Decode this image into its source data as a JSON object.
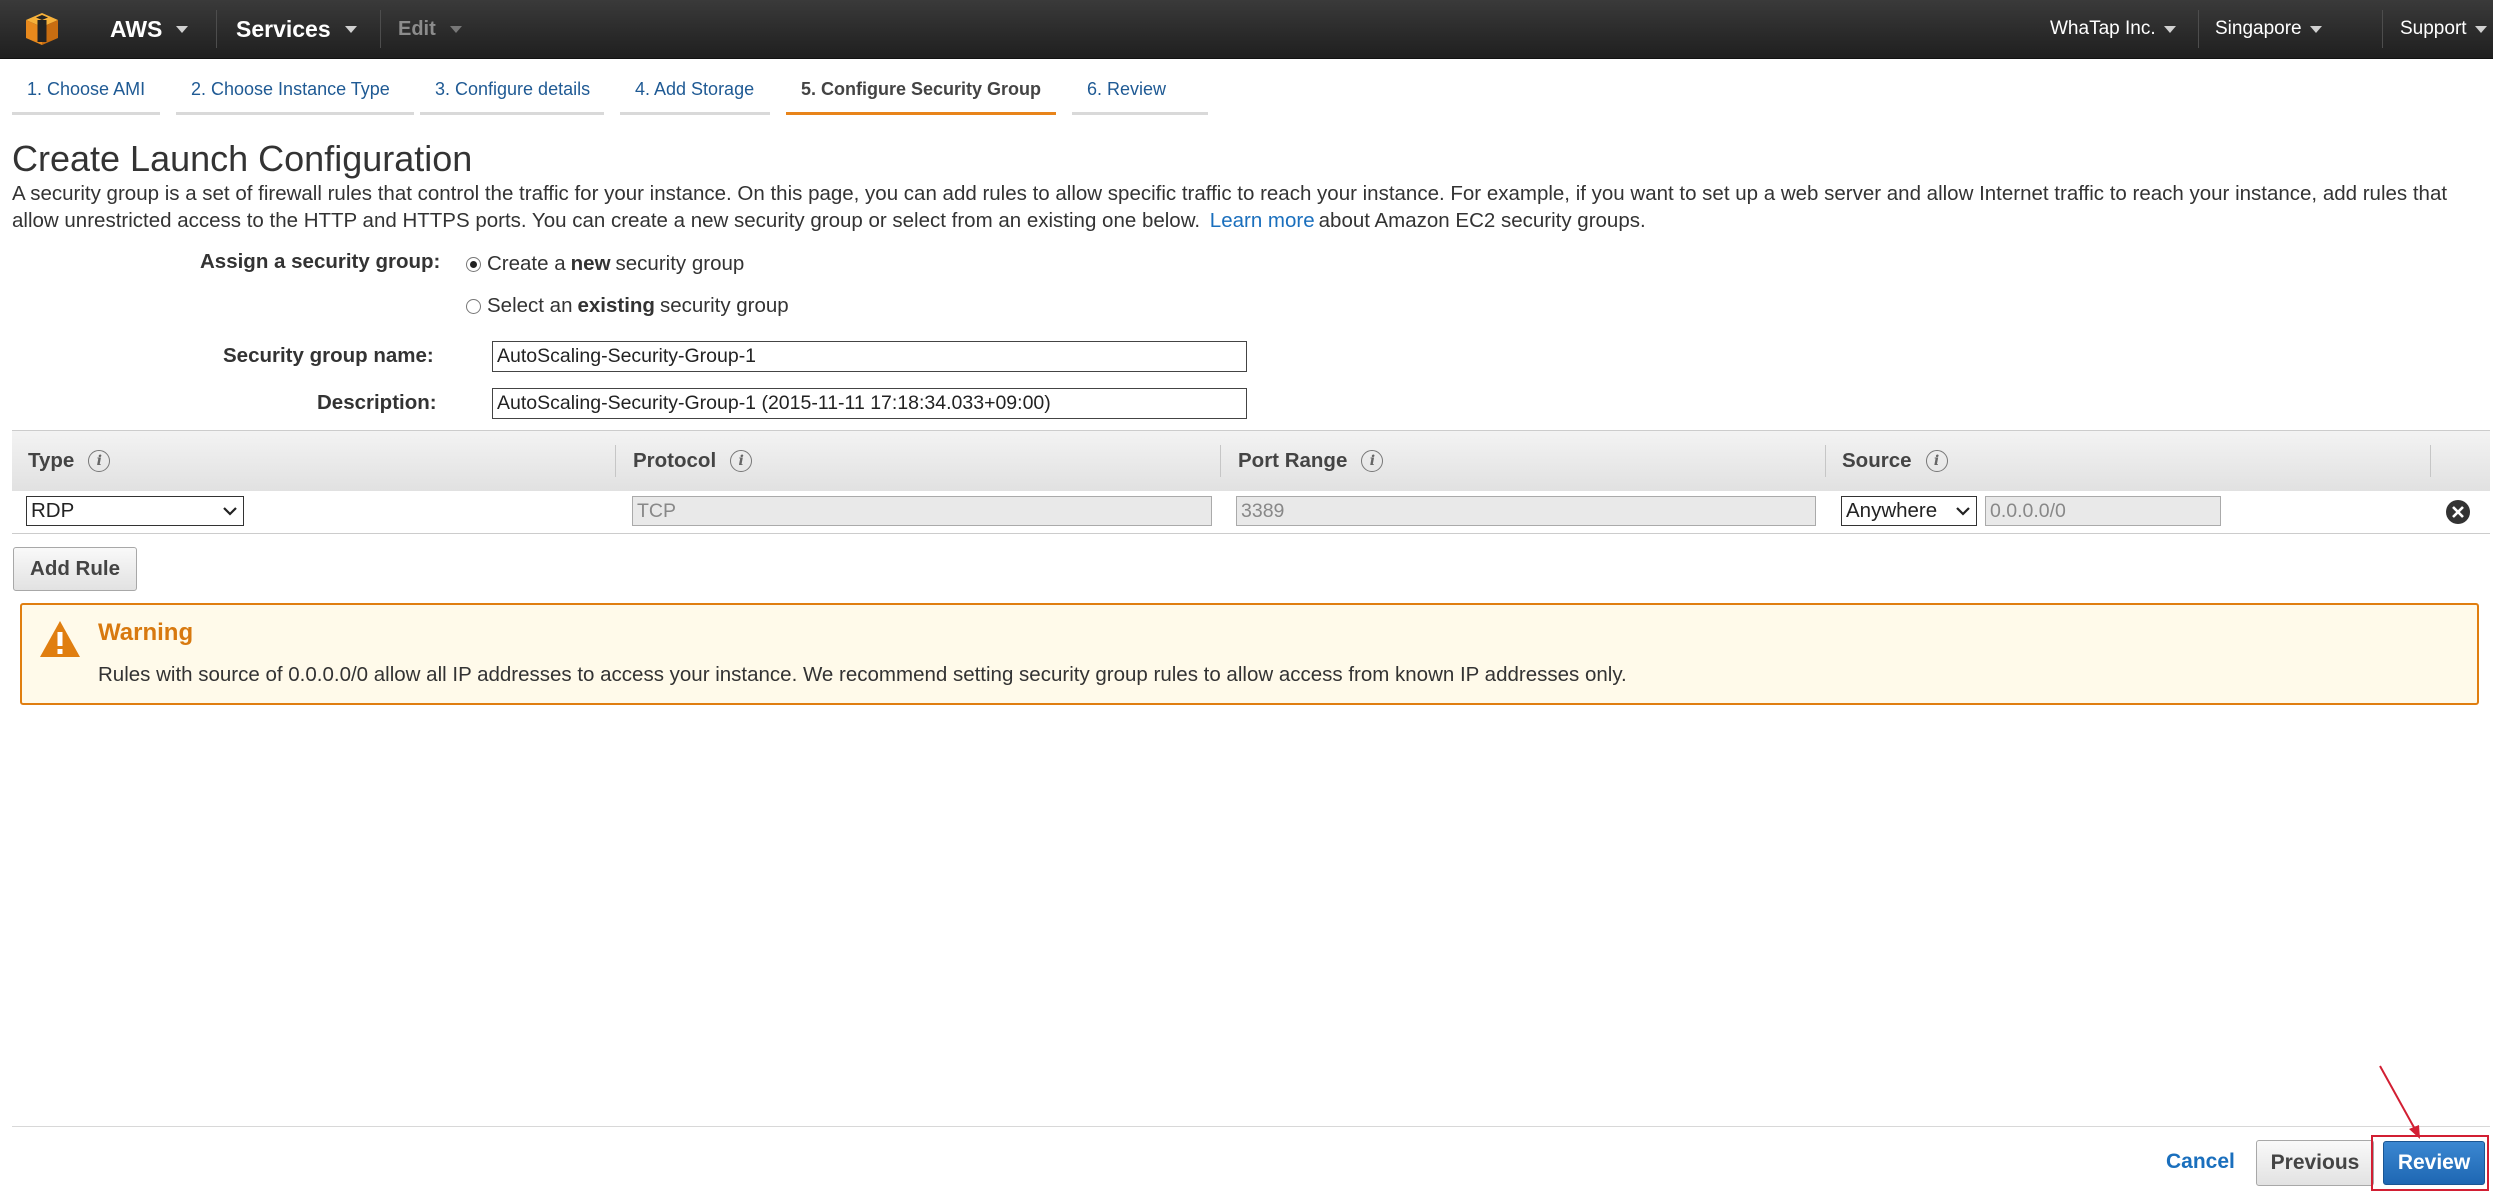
{
  "topnav": {
    "brand": "AWS",
    "services": "Services",
    "edit": "Edit",
    "account": "WhaTap Inc.",
    "region": "Singapore",
    "support": "Support",
    "logo_icon": "aws-cube-icon"
  },
  "wizard": {
    "steps": [
      {
        "label": "1. Choose AMI"
      },
      {
        "label": "2. Choose Instance Type"
      },
      {
        "label": "3. Configure details"
      },
      {
        "label": "4. Add Storage"
      },
      {
        "label": "5. Configure Security Group",
        "active": true
      },
      {
        "label": "6. Review"
      }
    ]
  },
  "page": {
    "title": "Create Launch Configuration",
    "intro_text": "A security group is a set of firewall rules that control the traffic for your instance. On this page, you can add rules to allow specific traffic to reach your instance. For example, if you want to set up a web server and allow Internet traffic to reach your instance, add rules that allow unrestricted access to the HTTP and HTTPS ports. You can create a new security group or select from an existing one below.",
    "learn_more": "Learn more",
    "intro_suffix": "about Amazon EC2 security groups."
  },
  "form": {
    "assign_label": "Assign a security group:",
    "option_new": {
      "prefix": "Create a",
      "bold": "new",
      "suffix": "security group",
      "selected": true
    },
    "option_existing": {
      "prefix": "Select an",
      "bold": "existing",
      "suffix": "security group",
      "selected": false
    },
    "name_label": "Security group name:",
    "name_value": "AutoScaling-Security-Group-1",
    "description_label": "Description:",
    "description_value": "AutoScaling-Security-Group-1 (2015-11-11 17:18:34.033+09:00)"
  },
  "rules_table": {
    "headers": [
      "Type",
      "Protocol",
      "Port Range",
      "Source"
    ],
    "rows": [
      {
        "type": "RDP",
        "protocol": "TCP",
        "port_range": "3389",
        "source": "Anywhere",
        "cidr": "0.0.0.0/0"
      }
    ],
    "add_rule": "Add Rule"
  },
  "warning": {
    "title": "Warning",
    "text": "Rules with source of 0.0.0.0/0 allow all IP addresses to access your instance. We recommend setting security group rules to allow access from known IP addresses only.",
    "icon": "warning-triangle-icon"
  },
  "footer": {
    "cancel": "Cancel",
    "previous": "Previous",
    "review": "Review"
  },
  "colors": {
    "nav_bg": "#232323",
    "link": "#1a6fbd",
    "active_tab_underline": "#e8841a",
    "warning_border": "#e07e10",
    "warning_bg": "#fffaea",
    "primary_button": "#2a76c2",
    "highlight": "#d21f33"
  }
}
